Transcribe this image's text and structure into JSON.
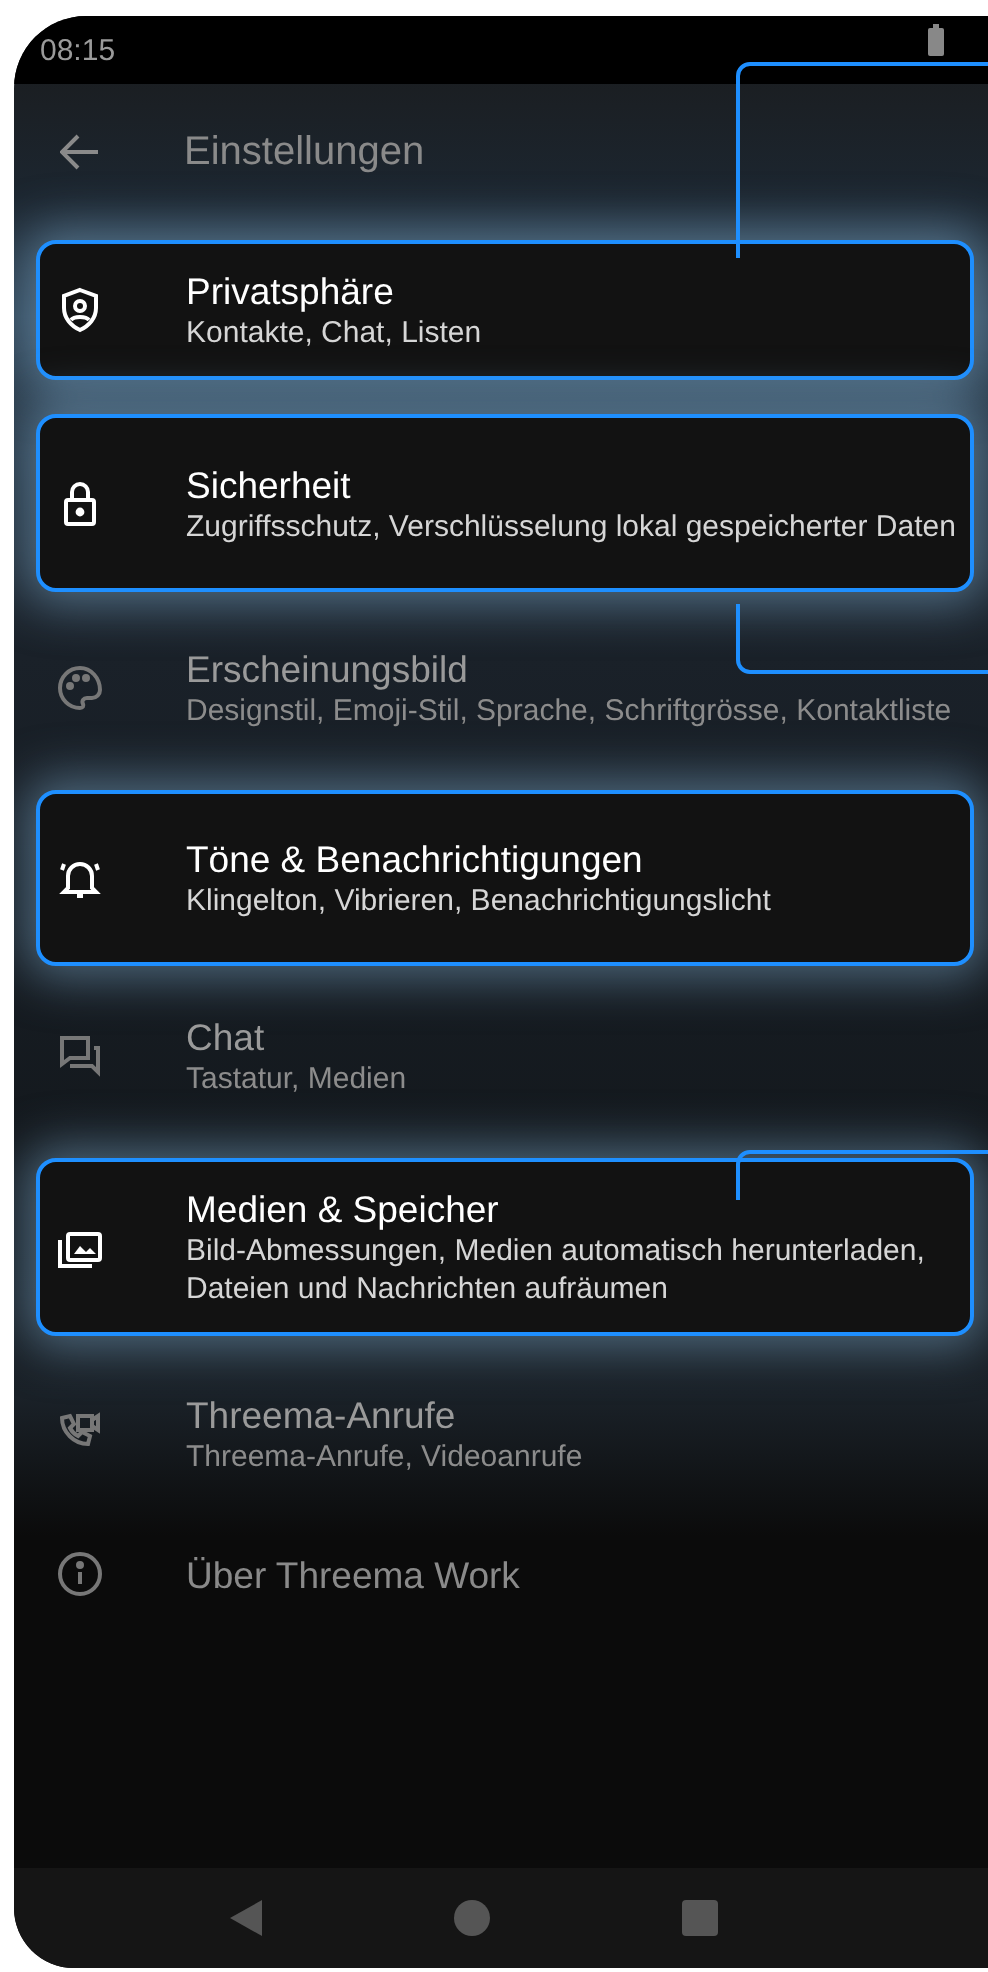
{
  "status_bar": {
    "time": "08:15"
  },
  "app_bar": {
    "title": "Einstellungen"
  },
  "settings": [
    {
      "title": "Privatsphäre",
      "subtitle": "Kontakte, Chat, Listen",
      "highlighted": true
    },
    {
      "title": "Sicherheit",
      "subtitle": "Zugriffsschutz, Verschlüsselung lokal gespeicherter Daten",
      "highlighted": true
    },
    {
      "title": "Erscheinungsbild",
      "subtitle": "Designstil, Emoji-Stil, Sprache, Schriftgrösse, Kontaktliste",
      "highlighted": false
    },
    {
      "title": "Töne & Benachrichtigungen",
      "subtitle": "Klingelton, Vibrieren, Benachrichtigungslicht",
      "highlighted": true
    },
    {
      "title": "Chat",
      "subtitle": "Tastatur, Medien",
      "highlighted": false
    },
    {
      "title": "Medien & Speicher",
      "subtitle": "Bild-Abmessungen, Medien automatisch herunterladen, Dateien und Nachrichten aufräumen",
      "highlighted": true
    },
    {
      "title": "Threema-Anrufe",
      "subtitle": "Threema-Anrufe, Videoanrufe",
      "highlighted": false
    },
    {
      "title": "Über Threema Work",
      "highlighted": false
    }
  ]
}
